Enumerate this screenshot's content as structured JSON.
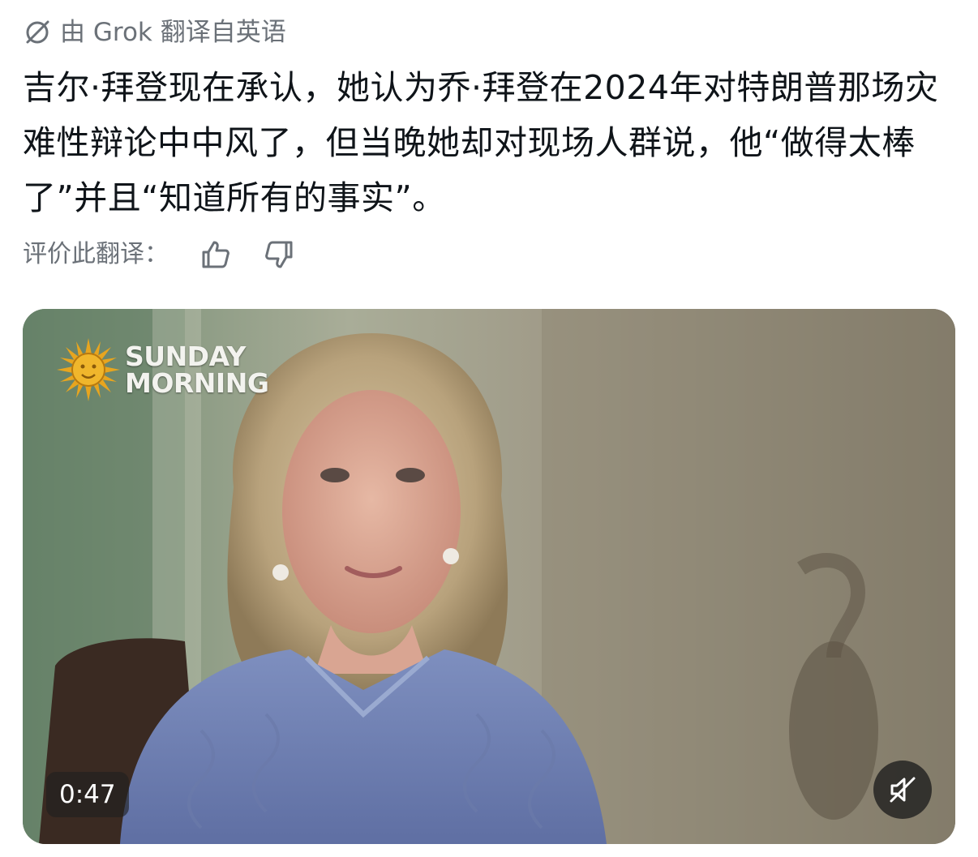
{
  "translation": {
    "label": "由 Grok 翻译自英语",
    "icon": "grok-icon"
  },
  "post": {
    "text": "吉尔·拜登现在承认，她认为乔·拜登在2024年对特朗普那场灾难性辩论中中风了，但当晚她却对现场人群说，他“做得太棒了”并且“知道所有的事实”。"
  },
  "rating": {
    "label": "评价此翻译：",
    "up_icon": "thumbs-up-icon",
    "down_icon": "thumbs-down-icon"
  },
  "video": {
    "show_logo_line1": "SUNDAY",
    "show_logo_line2": "MORNING",
    "duration": "0:47",
    "mute_icon": "muted-speaker-icon"
  },
  "colors": {
    "text_primary": "#0f1419",
    "text_secondary": "#6b7178",
    "badge_bg": "#1e1e1e"
  }
}
